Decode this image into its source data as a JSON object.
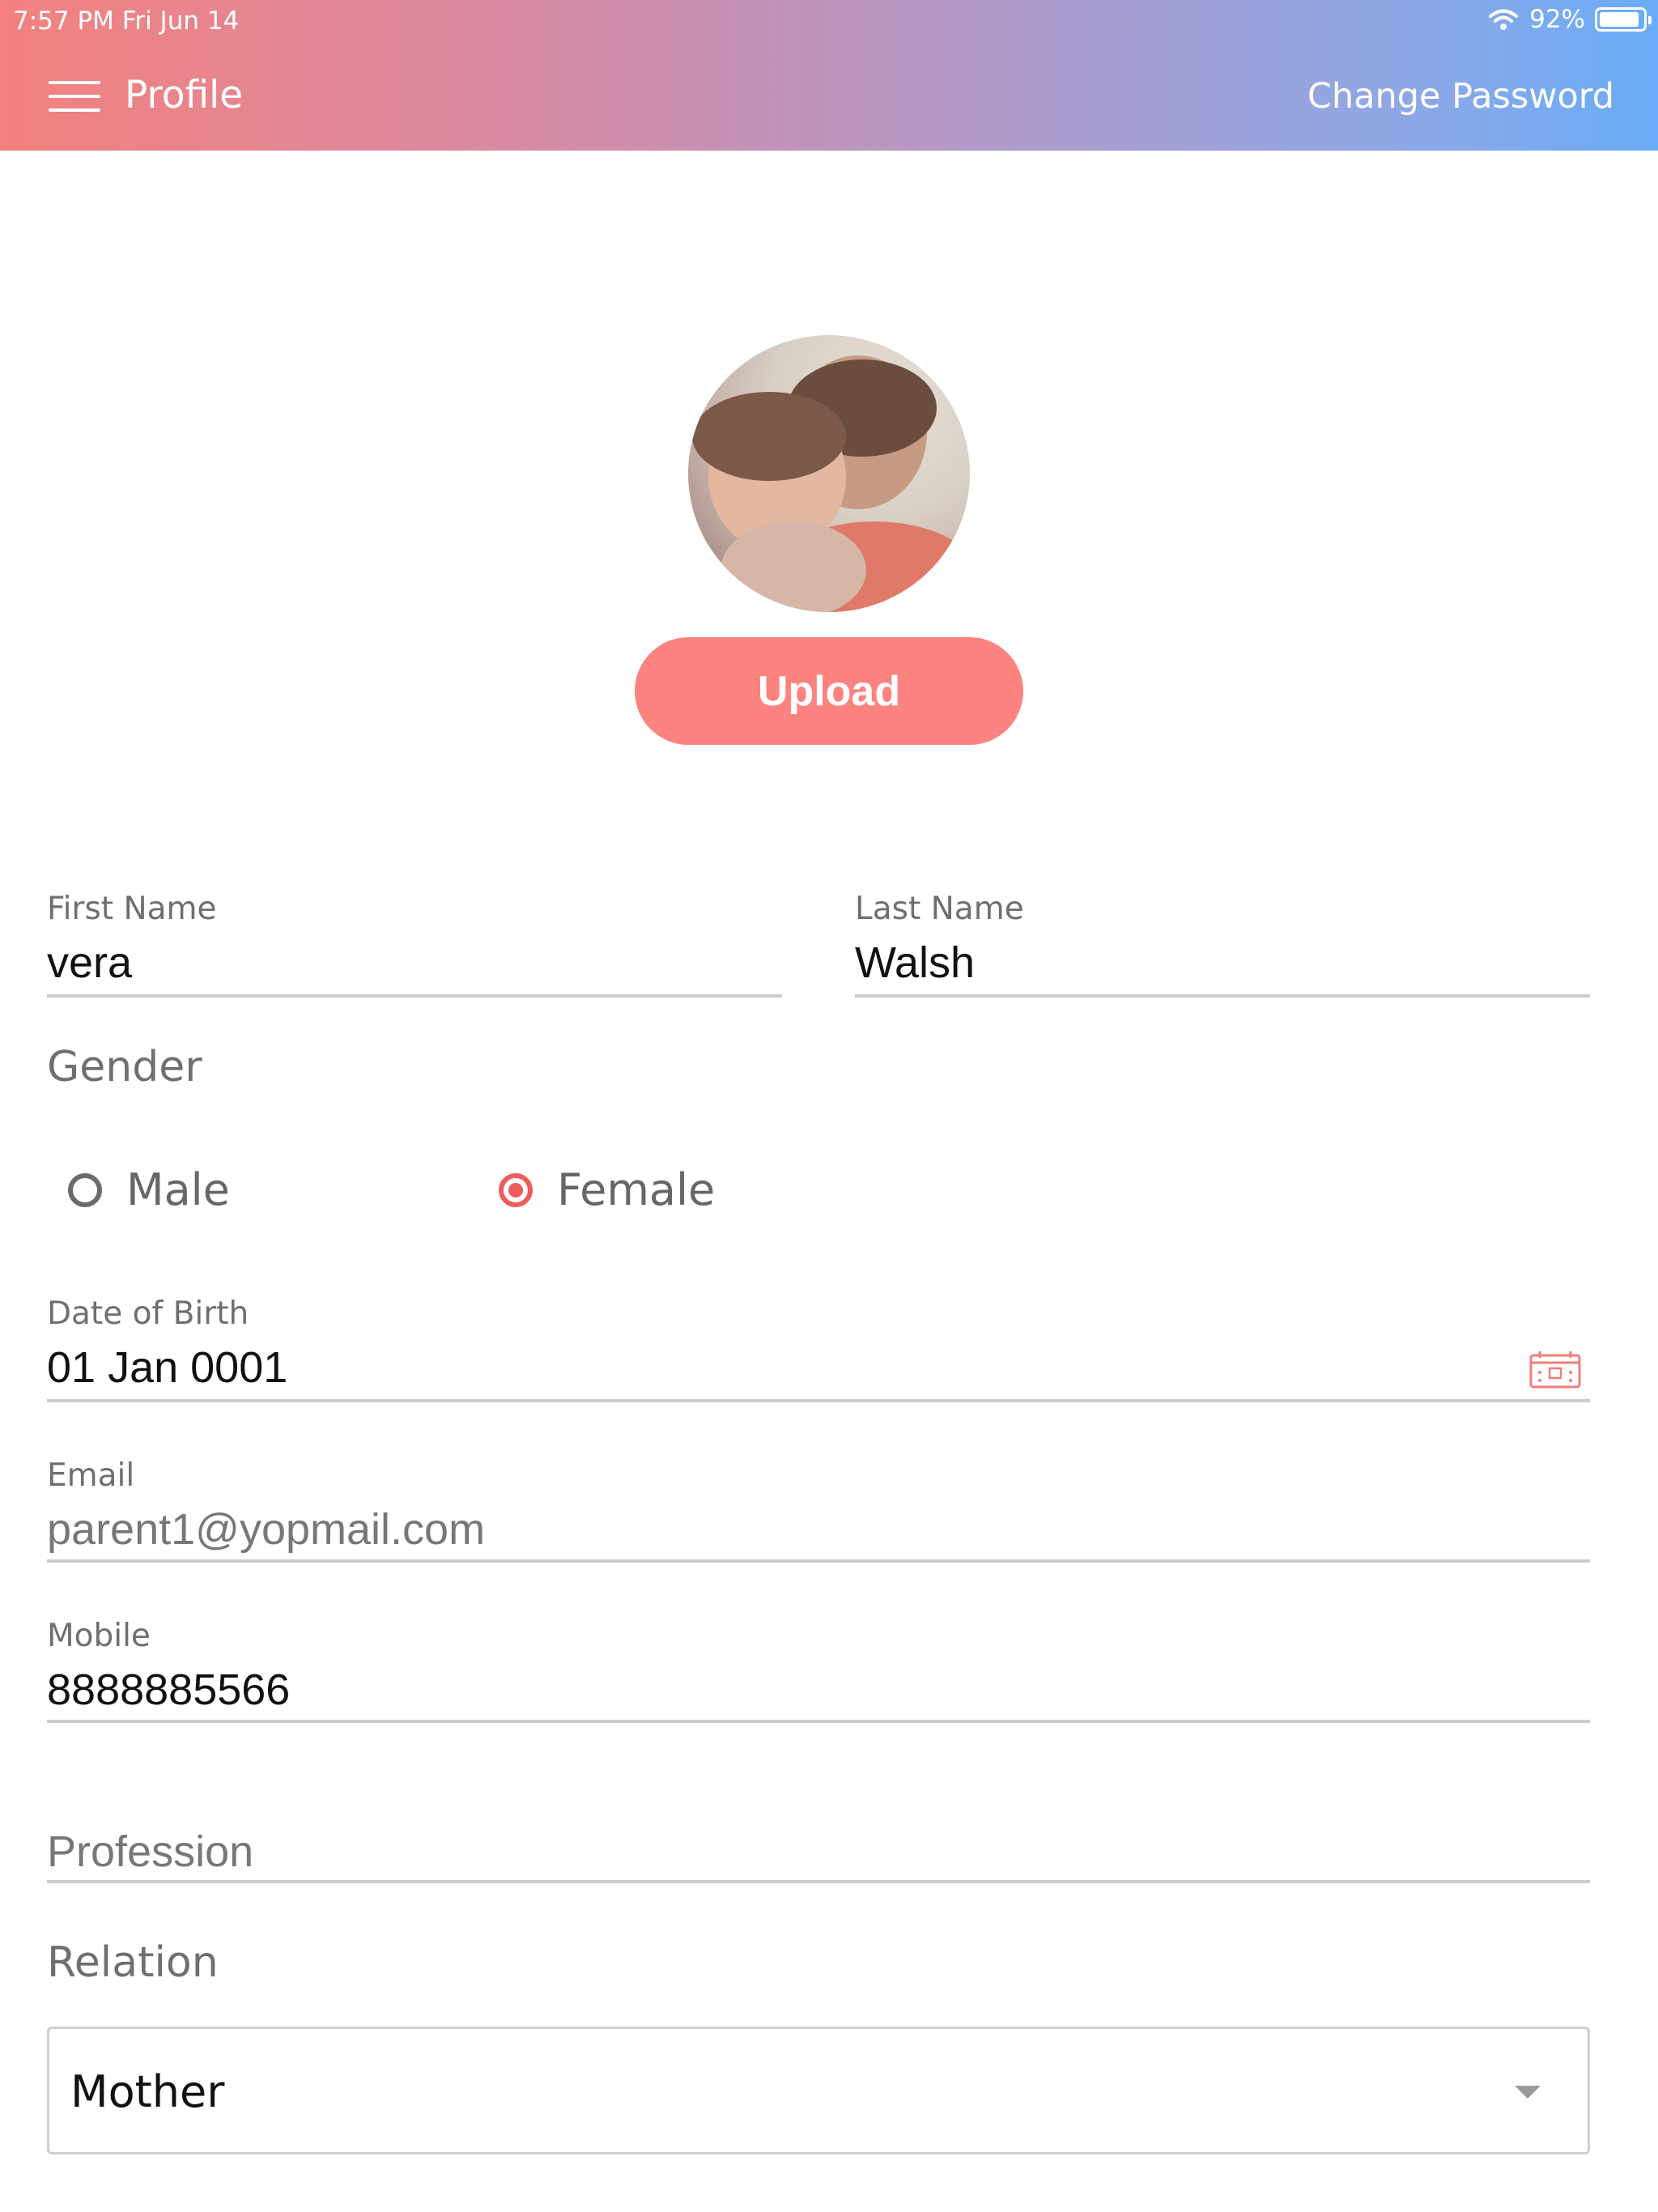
{
  "status_bar": {
    "time_date": "7:57 PM   Fri Jun 14",
    "battery": "92%",
    "battery_level": 0.92
  },
  "header": {
    "title": "Profile",
    "change_password": "Change Password"
  },
  "profile": {
    "upload_label": "Upload"
  },
  "form": {
    "first_name": {
      "label": "First Name",
      "value": "vera"
    },
    "last_name": {
      "label": "Last Name",
      "value": "Walsh"
    },
    "gender": {
      "label": "Gender",
      "options": [
        "Male",
        "Female"
      ],
      "selected": "Female"
    },
    "dob": {
      "label": "Date of Birth",
      "value": "01 Jan 0001"
    },
    "email": {
      "label": "Email",
      "value": "parent1@yopmail.com"
    },
    "mobile": {
      "label": "Mobile",
      "value": "8888885566"
    },
    "profession": {
      "placeholder": "Profession",
      "value": ""
    },
    "relation": {
      "label": "Relation",
      "selected": "Mother"
    }
  },
  "colors": {
    "accent": "#fd8380",
    "radio_selected": "#f05b5b",
    "gradient_start": "#f2817f",
    "gradient_end": "#6aacf7"
  },
  "icons": [
    "menu-icon",
    "wifi-icon",
    "battery-icon",
    "calendar-icon",
    "chevron-down-icon"
  ]
}
